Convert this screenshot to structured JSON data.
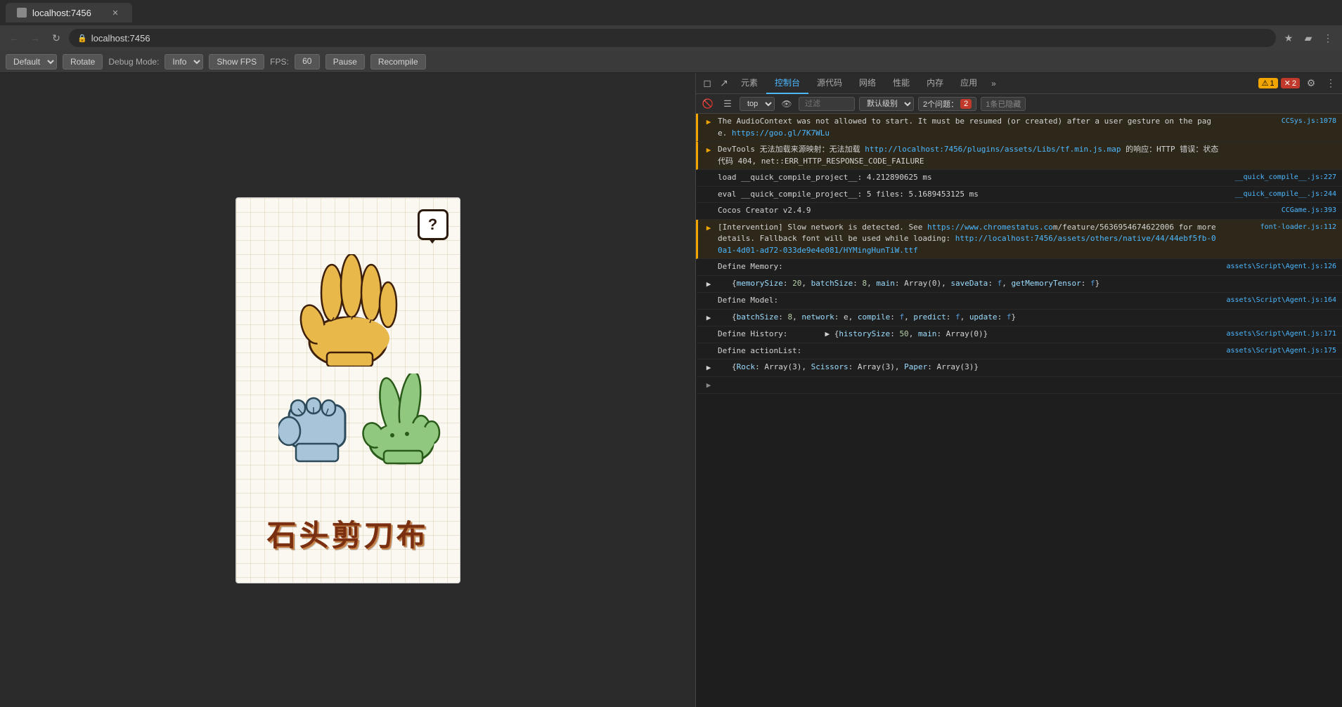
{
  "browser": {
    "url": "localhost:7456",
    "tab_title": "localhost:7456"
  },
  "toolbar": {
    "preset_label": "Default",
    "rotate_label": "Rotate",
    "debug_mode_label": "Debug Mode:",
    "debug_mode_value": "Info",
    "show_fps_label": "Show FPS",
    "fps_label": "FPS:",
    "fps_value": "60",
    "pause_label": "Pause",
    "recompile_label": "Recompile"
  },
  "game": {
    "title": "石头剪刀布",
    "help_icon": "?"
  },
  "devtools": {
    "tabs": [
      "元素",
      "控制台",
      "源代码",
      "网络",
      "性能",
      "内存",
      "应用"
    ],
    "active_tab": "控制台",
    "more_tabs": "»",
    "warning_count": "1",
    "error_count": "2",
    "top_label": "top",
    "eye_label": "👁",
    "filter_placeholder": "过滤",
    "level_label": "默认级别",
    "issues_label": "2个问题：",
    "issues_error": "2",
    "hidden_label": "1条已隐藏"
  },
  "console_messages": [
    {
      "type": "warning",
      "icon": "▶",
      "text": "The AudioContext was not allowed to start. It must be resumed (or created) after a user gesture on the page.",
      "link_text": "https://goo.gl/7K7WLu",
      "source": "CCSys.js:1078"
    },
    {
      "type": "warning",
      "icon": "▶",
      "text": "DevTools 无法加载来源映射：无法加载",
      "link_text": "http://localhost:7456/plugins/assets/Libs/tf.min.js.map",
      "text2": "的响应：HTTP 错误：状态代码 404, net::ERR_HTTP_RESPONSE_CODE_FAILURE",
      "source": ""
    },
    {
      "type": "info",
      "icon": "",
      "text": "load __quick_compile_project__: 4.212890625 ms",
      "link_text": "__quick_compile__.js:227",
      "source": "__quick_compile__.js:227"
    },
    {
      "type": "info",
      "icon": "",
      "text": "eval __quick_compile_project__: 5 files: 5.1689453125 ms",
      "link_text": "__quick_compile__.js:244",
      "source": "__quick_compile__.js:244"
    },
    {
      "type": "info",
      "icon": "",
      "text": "Cocos Creator v2.4.9",
      "source": "CCGame.js:393"
    },
    {
      "type": "warning",
      "icon": "▶",
      "text": "[Intervention] Slow network is detected. See",
      "link_text": "https://www.chromestatus.co",
      "text2": "m/feature/5636954674622006 for more details. Fallback font will be used while loading:",
      "link_text2": "http://localhost:7456/assets/others/native/44/44ebf5fb-00a1-4d01-ad72-033de9e4e081/HYMingHunTiW.ttf",
      "source": "font-loader.js:112"
    },
    {
      "type": "info",
      "icon": "",
      "text": "Define Memory:",
      "source": "assets\\Script\\Agent.js:126"
    },
    {
      "type": "info",
      "icon": "▶",
      "text": "{memorySize: 20, batchSize: 8, main: Array(0), saveData: f, getMemoryTensor: f}",
      "source": ""
    },
    {
      "type": "info",
      "icon": "",
      "text": "Define Model:",
      "source": "assets\\Script\\Agent.js:164"
    },
    {
      "type": "info",
      "icon": "▶",
      "text": "{batchSize: 8, network: e, compile: f, predict: f, update: f}",
      "source": ""
    },
    {
      "type": "info",
      "icon": "",
      "text": "Define History:",
      "source": "assets\\Script\\Agent.js:171"
    },
    {
      "type": "info",
      "icon": "▶",
      "text": "{historySize: 50, main: Array(0)}",
      "source": ""
    },
    {
      "type": "info",
      "icon": "",
      "text": "Define actionList:",
      "source": "assets\\Script\\Agent.js:175"
    },
    {
      "type": "info",
      "icon": "▶",
      "text": "{Rock: Array(3), Scissors: Array(3), Paper: Array(3)}",
      "source": ""
    },
    {
      "type": "info",
      "icon": "▶",
      "expand": true,
      "text": "",
      "source": ""
    }
  ]
}
